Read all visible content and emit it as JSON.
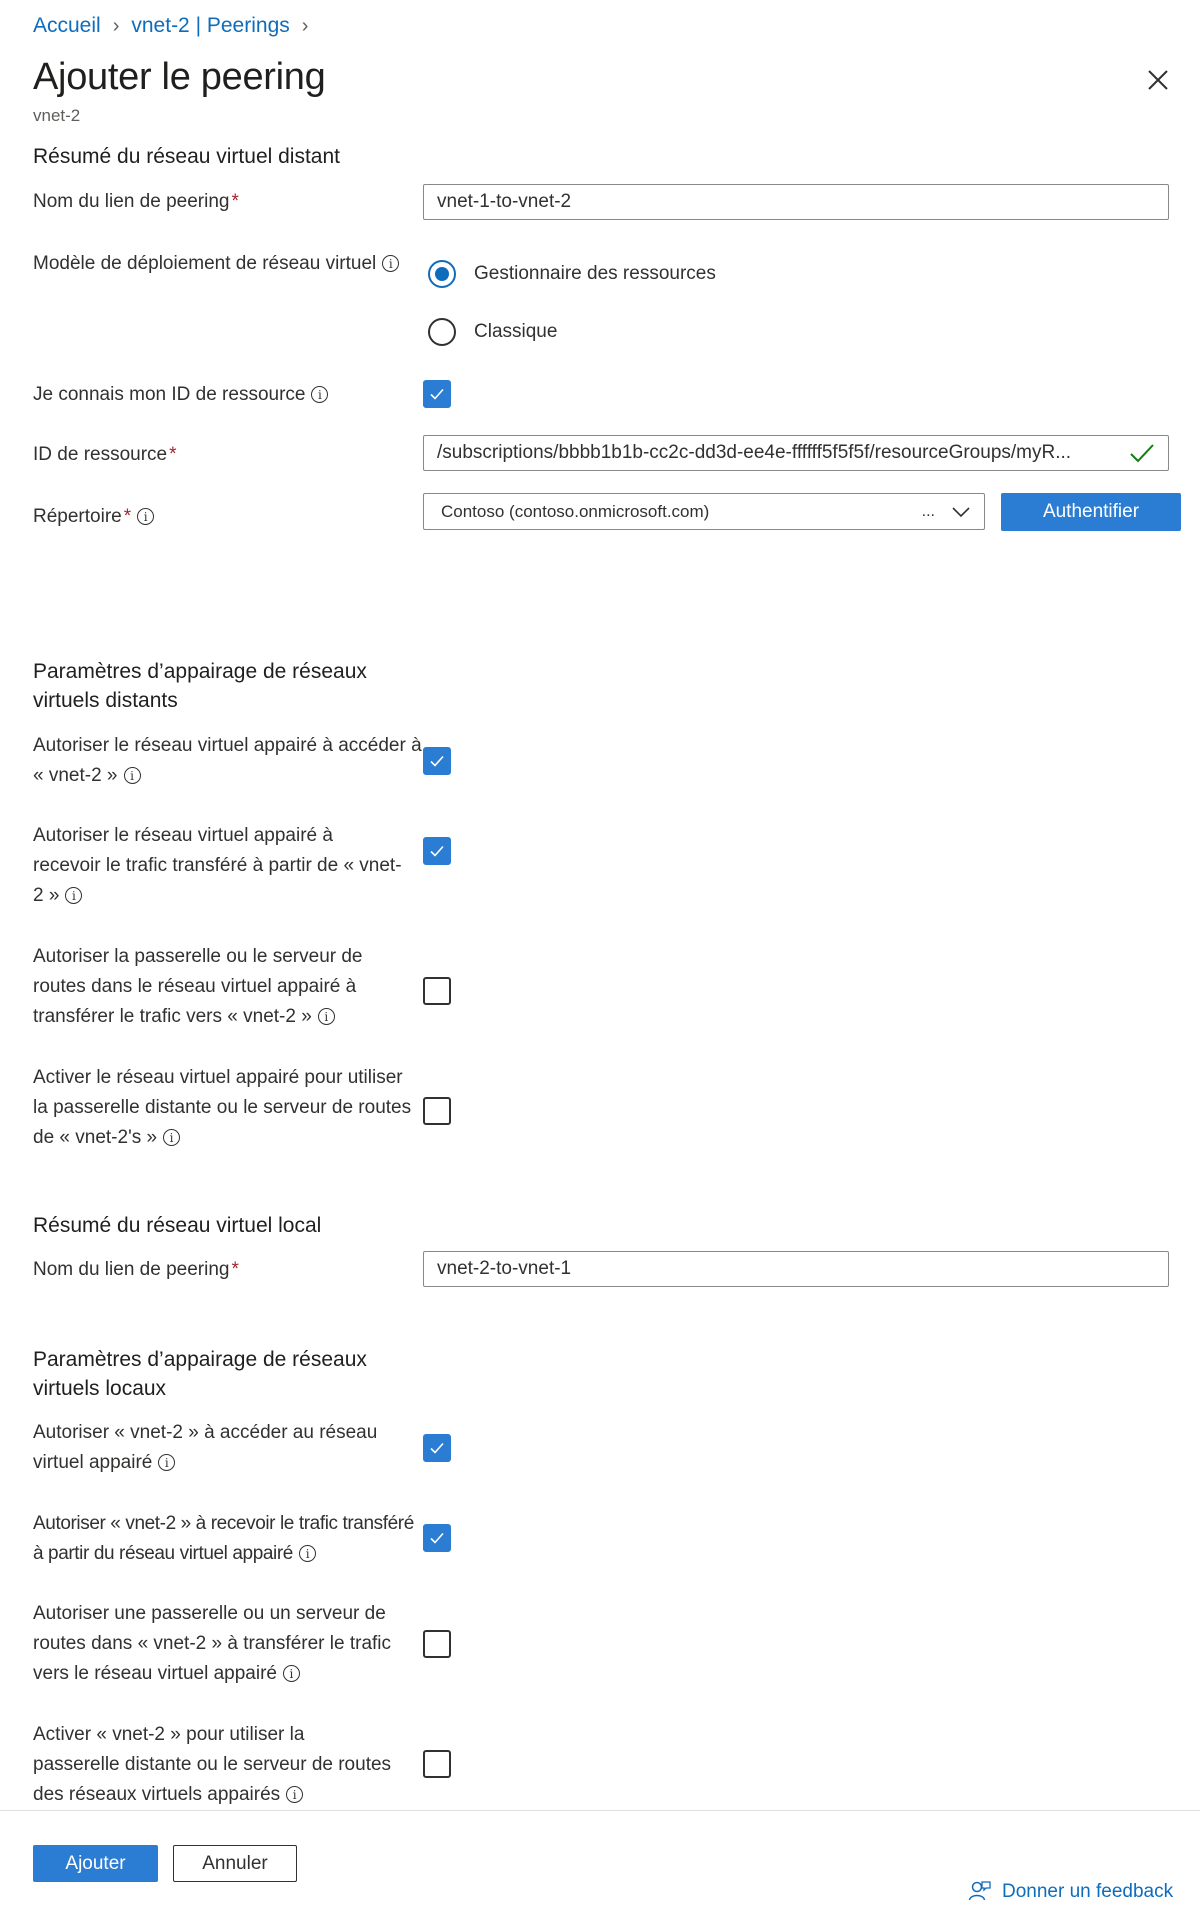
{
  "breadcrumb": {
    "home": "Accueil",
    "parent": "vnet-2 | Peerings"
  },
  "header": {
    "title": "Ajouter le peering",
    "subtitle": "vnet-2"
  },
  "remote_summary": {
    "section_title": "Résumé du réseau virtuel distant",
    "peering_link_label": "Nom du lien de peering",
    "peering_link_value": "vnet-1-to-vnet-2",
    "deployment_model_label": "Modèle de déploiement de réseau virtuel",
    "deployment_options": [
      "Gestionnaire des ressources",
      "Classique"
    ],
    "deployment_selected": "Gestionnaire des ressources",
    "know_resource_id_label": "Je connais mon ID de ressource",
    "know_resource_id_checked": true,
    "resource_id_label": "ID de ressource",
    "resource_id_value": "/subscriptions/bbbb1b1b-cc2c-dd3d-ee4e-ffffff5f5f5f/resourceGroups/myR...",
    "directory_label": "Répertoire",
    "directory_value": "Contoso (contoso.onmicrosoft.com)",
    "directory_more": "...",
    "authenticate_label": "Authentifier"
  },
  "remote_settings": {
    "section_title": "Paramètres d’appairage de réseaux virtuels distants",
    "options": [
      {
        "label": "Autoriser le réseau virtuel appairé à accéder à « vnet-2 »",
        "checked": true
      },
      {
        "label": "Autoriser le réseau virtuel appairé à recevoir le trafic transféré à partir de « vnet-2 »",
        "checked": true
      },
      {
        "label": "Autoriser la passerelle ou le serveur de routes dans le réseau virtuel appairé à transférer le trafic vers « vnet-2 »",
        "checked": false
      },
      {
        "label": "Activer le réseau virtuel appairé pour utiliser la passerelle distante ou le serveur de routes de « vnet-2's »",
        "checked": false
      }
    ]
  },
  "local_summary": {
    "section_title": "Résumé du réseau virtuel local",
    "peering_link_label": "Nom du lien de peering",
    "peering_link_value": "vnet-2-to-vnet-1"
  },
  "local_settings": {
    "section_title": "Paramètres d’appairage de réseaux virtuels locaux",
    "options": [
      {
        "label": "Autoriser « vnet-2 » à accéder au réseau virtuel appairé",
        "checked": true
      },
      {
        "label": "Autoriser « vnet-2 » à recevoir le trafic transféré à partir du réseau virtuel appairé",
        "checked": true
      },
      {
        "label": "Autoriser une passerelle ou un serveur de routes dans « vnet-2 » à transférer le trafic vers le réseau virtuel appairé",
        "checked": false
      },
      {
        "label": "Activer « vnet-2 » pour utiliser la passerelle distante ou le serveur de routes des réseaux virtuels appairés",
        "checked": false
      }
    ]
  },
  "footer": {
    "add_label": "Ajouter",
    "cancel_label": "Annuler",
    "feedback_label": "Donner un feedback"
  },
  "colors": {
    "accent": "#2b7cd3",
    "link": "#0f6cbd",
    "required": "#a4262c",
    "valid": "#107c10"
  },
  "info_glyph": "i"
}
